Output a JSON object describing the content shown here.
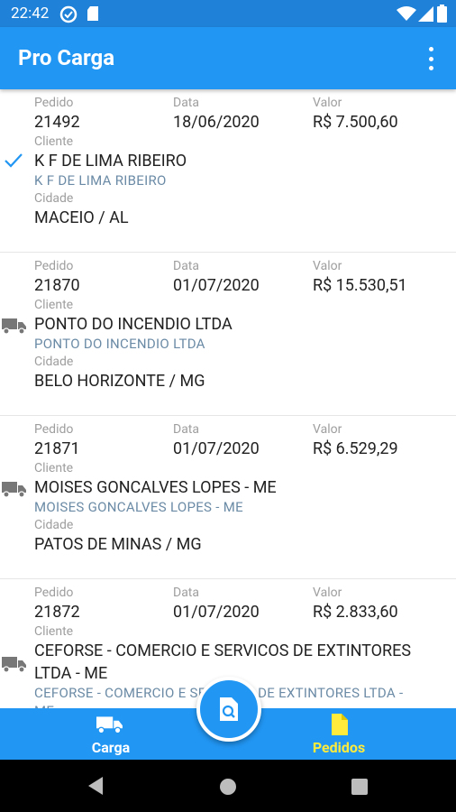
{
  "status_bar": {
    "time": "22:42"
  },
  "app": {
    "title": "Pro Carga"
  },
  "labels": {
    "pedido": "Pedido",
    "data": "Data",
    "valor": "Valor",
    "cliente": "Cliente",
    "cidade": "Cidade"
  },
  "orders": [
    {
      "pedido": "21492",
      "data": "18/06/2020",
      "valor": "R$ 7.500,60",
      "cliente": "K F DE LIMA RIBEIRO",
      "cliente_sub": "K F DE LIMA RIBEIRO",
      "cidade": "MACEIO / AL",
      "status_icon": "check-icon"
    },
    {
      "pedido": "21870",
      "data": "01/07/2020",
      "valor": "R$ 15.530,51",
      "cliente": "PONTO DO INCENDIO LTDA",
      "cliente_sub": "PONTO DO INCENDIO LTDA",
      "cidade": "BELO HORIZONTE / MG",
      "status_icon": "truck-icon"
    },
    {
      "pedido": "21871",
      "data": "01/07/2020",
      "valor": "R$ 6.529,29",
      "cliente": "MOISES GONCALVES LOPES - ME",
      "cliente_sub": "MOISES GONCALVES LOPES - ME",
      "cidade": "PATOS DE MINAS / MG",
      "status_icon": "truck-icon"
    },
    {
      "pedido": "21872",
      "data": "01/07/2020",
      "valor": "R$ 2.833,60",
      "cliente_line1": "CEFORSE - COMERCIO E SERVICOS DE EXTINTORES",
      "cliente_line2": "LTDA - ME",
      "cliente_sub_line1": "CEFORSE - COMERCIO E SERVICOS DE EXTINTORES LTDA -",
      "cliente_sub_line2": "ME",
      "status_icon": "truck-icon"
    }
  ],
  "bottom_nav": {
    "tabs": [
      {
        "label": "Carga",
        "icon": "truck-icon",
        "color": "#ffffff"
      },
      {
        "label": "Pedidos",
        "icon": "document-icon",
        "color": "#ffeb3b"
      }
    ],
    "fab_icon": "search-document-icon"
  },
  "colors": {
    "primary": "#2196f3",
    "active_tab": "#ffeb3b",
    "check": "#2196f3"
  }
}
